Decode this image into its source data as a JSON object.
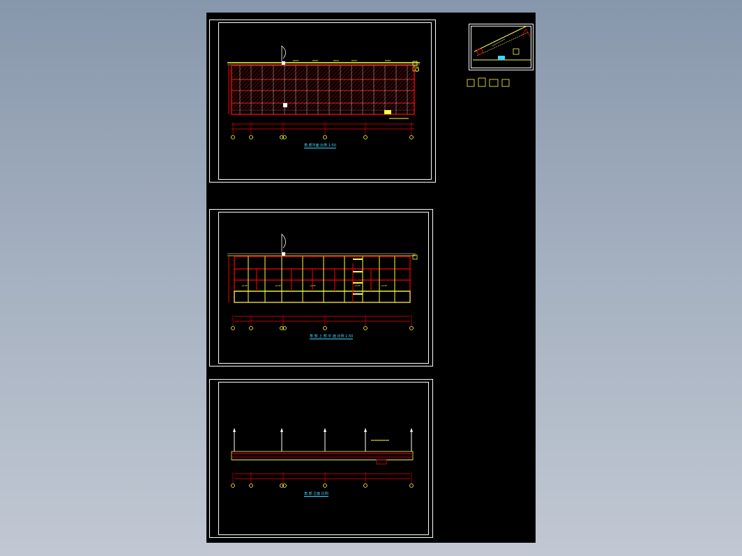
{
  "colors": {
    "background": "#000000",
    "frame": "#ffffff",
    "grid_red": "#ff0000",
    "grid_yellow": "#ffff40",
    "caption_cyan": "#3fd5ff",
    "hatch_red": "#c00000"
  },
  "sheets": {
    "plan_top": {
      "caption": "角 部平面 比例 1:50"
    },
    "plan_middle": {
      "caption": "角 部 上 部 平 面 比例 1:50"
    },
    "plan_bottom": {
      "caption": "角 部 立面 比例"
    }
  },
  "labels": {
    "pipe_tags": [
      "DN25",
      "DN20",
      "DN15",
      "DN15",
      "DN20"
    ],
    "slab_label": "+0.5F"
  }
}
